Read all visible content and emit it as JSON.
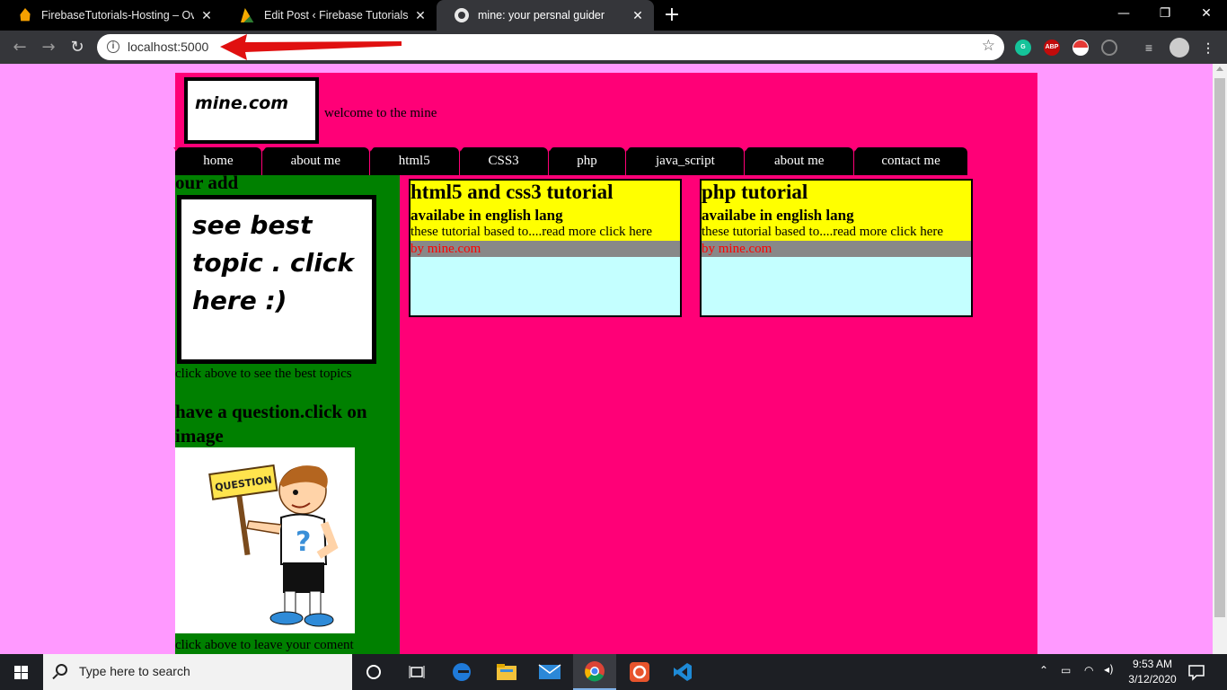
{
  "browser": {
    "tabs": [
      {
        "title": "FirebaseTutorials-Hosting – Over",
        "favicon": "firebase-icon",
        "active": false
      },
      {
        "title": "Edit Post ‹ Firebase Tutorials — W",
        "favicon": "firebase-blogger-icon",
        "active": false
      },
      {
        "title": "mine: your persnal guider",
        "favicon": "globe-icon",
        "active": true
      }
    ],
    "new_tab_glyph": "+",
    "window_controls": {
      "minimize": "—",
      "maximize": "❐",
      "close": "✕"
    },
    "address": "localhost:5000",
    "extensions": [
      "grammarly-icon",
      "adblock-icon",
      "pokeball-icon",
      "history-icon",
      "media-icon",
      "profile-avatar",
      "menu-icon"
    ],
    "extension_labels": {
      "adblock": "ABP"
    }
  },
  "page": {
    "logo": "mine.com",
    "welcome": "welcome to the mine",
    "menu": [
      "home",
      "about me",
      "html5",
      "CSS3",
      "php",
      "java_script",
      "about me",
      "contact me"
    ],
    "sidebar": {
      "title": "our add",
      "ad_text": "see best topic . click here :)",
      "ad_caption": "click above to see the best topics",
      "question_title": "have a question.click on image",
      "question_sign": "QUESTION",
      "question_caption": "click above to leave your coment"
    },
    "cards": [
      {
        "title": "html5 and css3 tutorial",
        "subtitle": "availabe in english lang",
        "description": "these tutorial based to....read more click here",
        "byline": "by mine.com"
      },
      {
        "title": "php tutorial",
        "subtitle": "availabe in english lang",
        "description": "these tutorial based to....read more click here",
        "byline": "by mine.com"
      }
    ],
    "colors": {
      "page_bg": "#ff99ff",
      "container_bg": "#ff0077",
      "sidebar_bg": "#008000",
      "card_head": "#ffff00",
      "card_body": "#c4ffff",
      "byline_bg": "#888888",
      "byline_text": "#ff0000"
    }
  },
  "taskbar": {
    "search_placeholder": "Type here to search",
    "apps": [
      "cortana-icon",
      "task-view-icon",
      "edge-icon",
      "file-explorer-icon",
      "mail-icon",
      "chrome-icon",
      "screen-recorder-icon",
      "vscode-icon"
    ],
    "time": "9:53 AM",
    "date": "3/12/2020"
  }
}
